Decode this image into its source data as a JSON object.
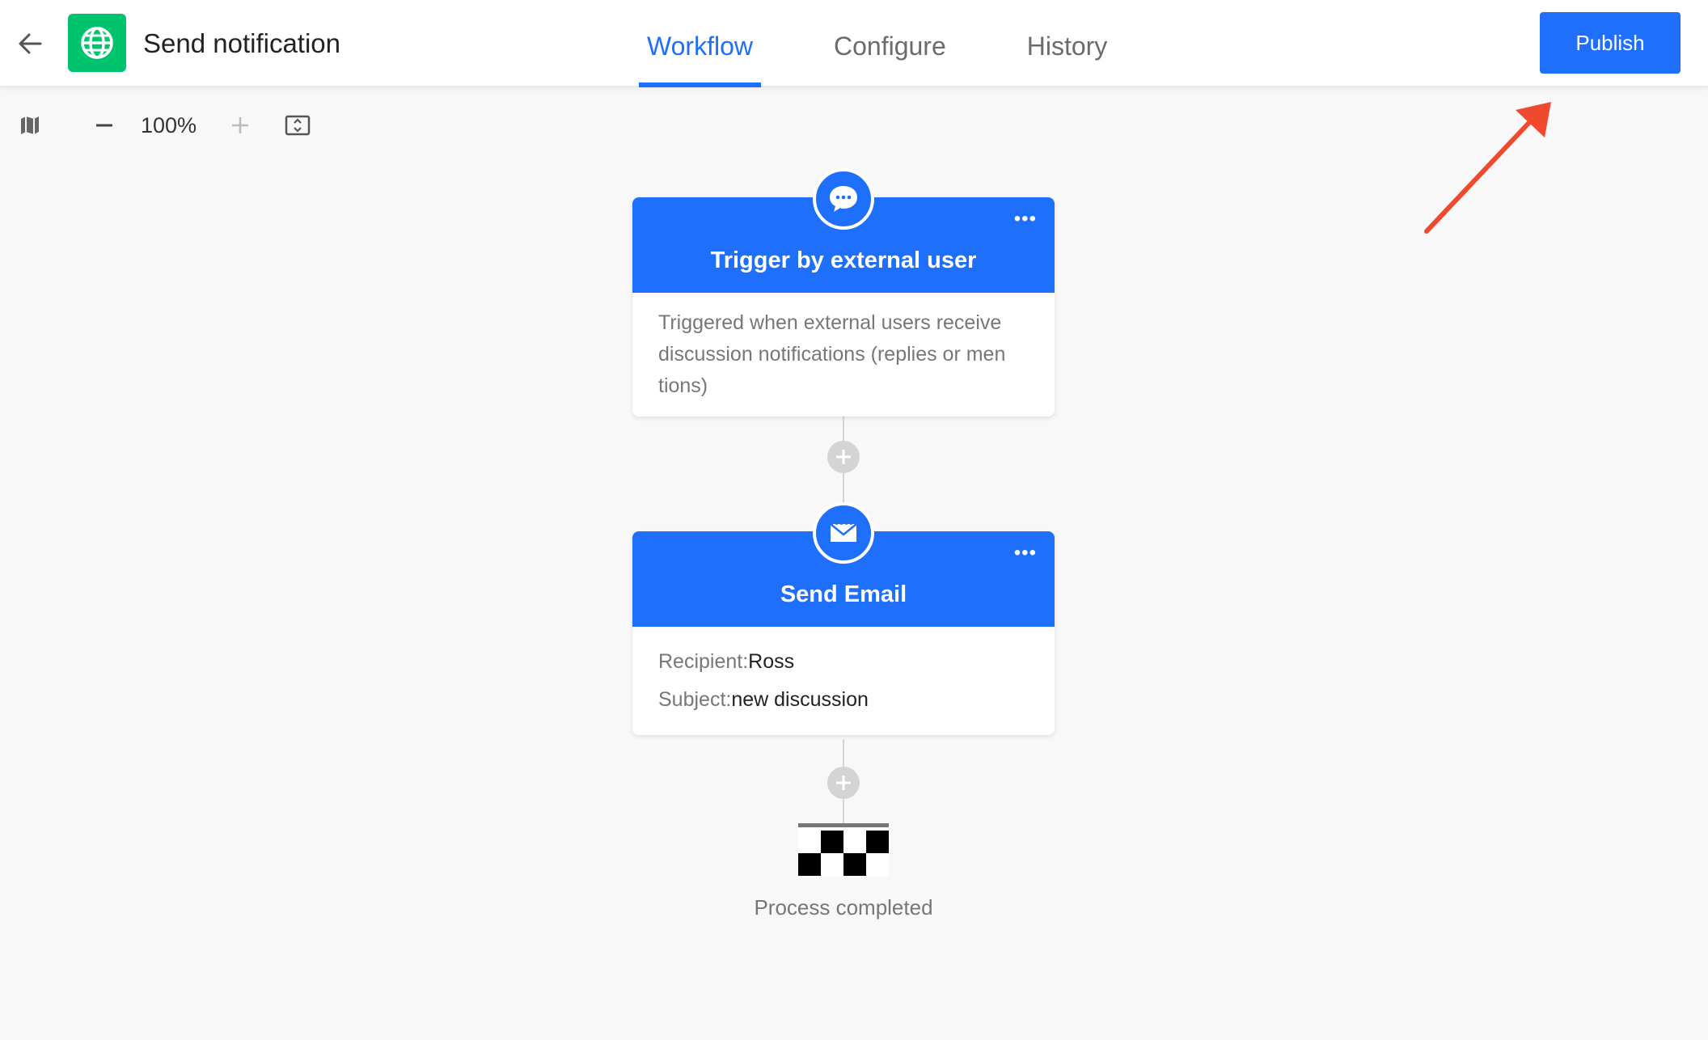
{
  "header": {
    "app_title": "Send notification",
    "tabs": [
      {
        "label": "Workflow",
        "active": true
      },
      {
        "label": "Configure",
        "active": false
      },
      {
        "label": "History",
        "active": false
      }
    ],
    "publish_label": "Publish",
    "logo_color": "#00c36e"
  },
  "toolbar": {
    "zoom_level": "100%",
    "icons": [
      "map-icon",
      "zoom-out-icon",
      "zoom-in-icon",
      "fit-view-icon"
    ]
  },
  "workflow": {
    "trigger_node": {
      "title": "Trigger by external user",
      "description_lines": [
        "Triggered when external users receive",
        "discussion notifications (replies or men",
        "tions)"
      ],
      "icon": "chat-bubble-icon"
    },
    "email_node": {
      "title": "Send Email",
      "recipient_label": "Recipient:",
      "recipient_value": "Ross",
      "subject_label": "Subject:",
      "subject_value": "new discussion",
      "icon": "envelope-icon"
    },
    "end_label": "Process completed"
  },
  "colors": {
    "primary": "#1e6ffb",
    "annotation": "#f04a2e",
    "canvas": "#f8f8f8"
  }
}
